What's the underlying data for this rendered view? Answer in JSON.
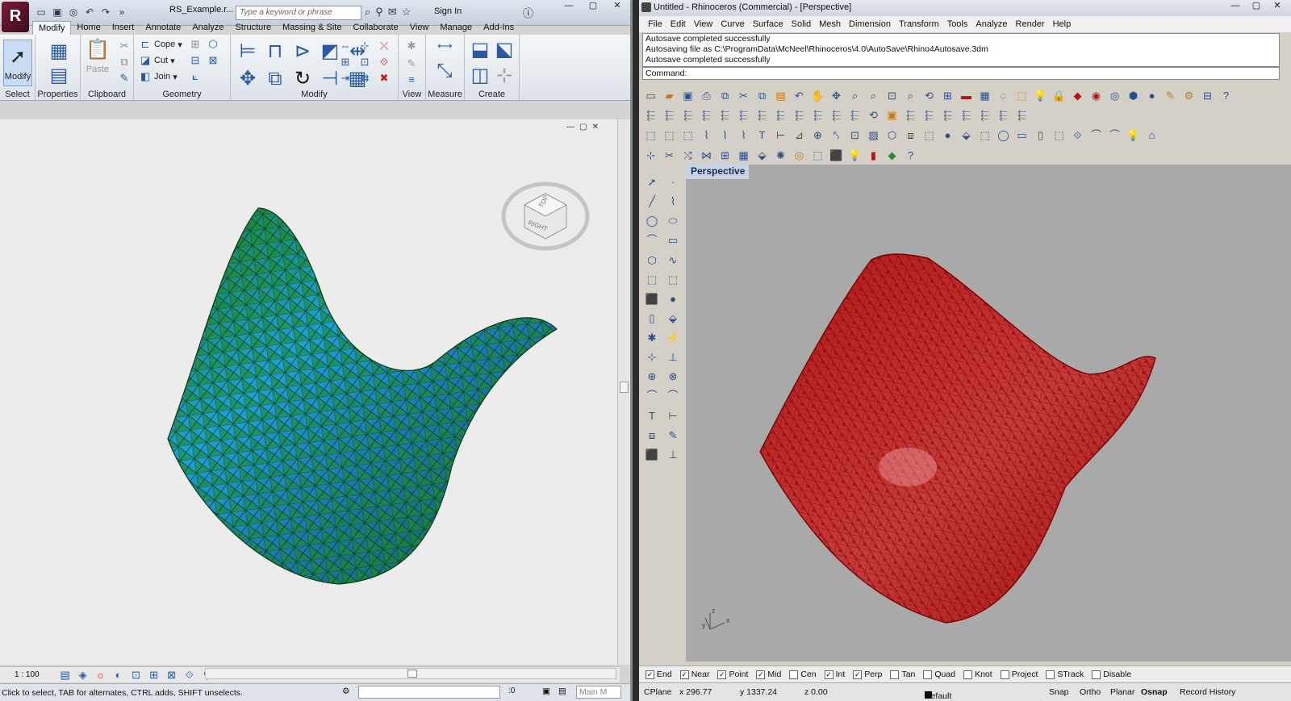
{
  "revit": {
    "logo": "R",
    "filename": "RS_Example.r...",
    "search_placeholder": "Type a keyword or phrase",
    "sign_in": "Sign In",
    "tabs": [
      "Modify",
      "Home",
      "Insert",
      "Annotate",
      "Analyze",
      "Structure",
      "Massing & Site",
      "Collaborate",
      "View",
      "Manage",
      "Add-Ins"
    ],
    "active_tab": "Modify",
    "modify_btn": "Modify",
    "paste_btn": "Paste",
    "cope_btn": "Cope",
    "cut_btn": "Cut",
    "join_btn": "Join",
    "panels": {
      "select": "Select",
      "properties": "Properties",
      "clipboard": "Clipboard",
      "geometry": "Geometry",
      "modify": "Modify",
      "view": "View",
      "measure": "Measure",
      "create": "Create"
    },
    "viewcube_top": "TOP",
    "viewcube_right": "RIGHT",
    "scale": "1 : 100",
    "status_text": "Click to select, TAB for alternates, CTRL adds, SHIFT unselects.",
    "status_zero": ":0",
    "main_model": "Main M"
  },
  "rhino": {
    "title": "Untitled - Rhinoceros (Commercial) - [Perspective]",
    "menu": [
      "File",
      "Edit",
      "View",
      "Curve",
      "Surface",
      "Solid",
      "Mesh",
      "Dimension",
      "Transform",
      "Tools",
      "Analyze",
      "Render",
      "Help"
    ],
    "history": [
      "Autosave completed successfully",
      "Autosaving file as C:\\ProgramData\\McNeel\\Rhinoceros\\4.0\\AutoSave\\Rhino4Autosave.3dm",
      "Autosave completed successfully"
    ],
    "command_label": "Command:",
    "viewport_label": "Perspective",
    "osnaps": [
      {
        "label": "End",
        "checked": true
      },
      {
        "label": "Near",
        "checked": true
      },
      {
        "label": "Point",
        "checked": true
      },
      {
        "label": "Mid",
        "checked": true
      },
      {
        "label": "Cen",
        "checked": false
      },
      {
        "label": "Int",
        "checked": true
      },
      {
        "label": "Perp",
        "checked": true
      },
      {
        "label": "Tan",
        "checked": false
      },
      {
        "label": "Quad",
        "checked": false
      },
      {
        "label": "Knot",
        "checked": false
      },
      {
        "label": "Project",
        "checked": false
      },
      {
        "label": "STrack",
        "checked": false
      },
      {
        "label": "Disable",
        "checked": false
      }
    ],
    "status": {
      "cplane": "CPlane",
      "x": "x 296.77",
      "y": "y 1337.24",
      "z": "z 0.00",
      "layer": "Default",
      "snap": "Snap",
      "ortho": "Ortho",
      "planar": "Planar",
      "osnap": "Osnap",
      "record_history": "Record History"
    },
    "axis_y": "y",
    "axis_x": "x",
    "axis_z": "z"
  },
  "colors": {
    "revit_green": "#1f8a1f",
    "revit_blue": "#1e88c8",
    "rhino_red": "#a81212"
  }
}
